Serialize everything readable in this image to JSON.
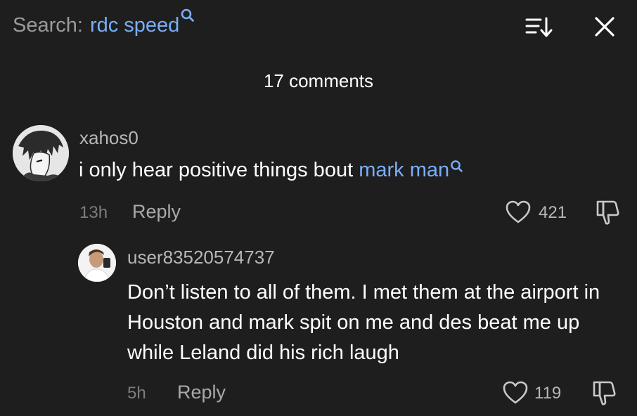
{
  "header": {
    "search_prefix": "Search:",
    "search_term": "rdc speed",
    "sort_icon": "sort-down-icon",
    "close_icon": "close-icon"
  },
  "comments_count": "17 comments",
  "comments": [
    {
      "username": "xahos0",
      "text_plain": "i only hear positive things bout ",
      "mention": "mark man",
      "time": "13h",
      "reply_label": "Reply",
      "likes": "421",
      "avatar": "anime-character-avatar"
    },
    {
      "username": "user83520574737",
      "text": "Don’t listen to all of them. I met them at the airport in Houston and mark spit on me and des beat me up while Leland did his rich laugh",
      "time": "5h",
      "reply_label": "Reply",
      "likes": "119",
      "avatar": "person-photo-avatar"
    }
  ],
  "colors": {
    "background": "#1e1e1e",
    "link": "#79aef8",
    "muted": "#7d7d7d",
    "username": "#b7b7b7"
  }
}
